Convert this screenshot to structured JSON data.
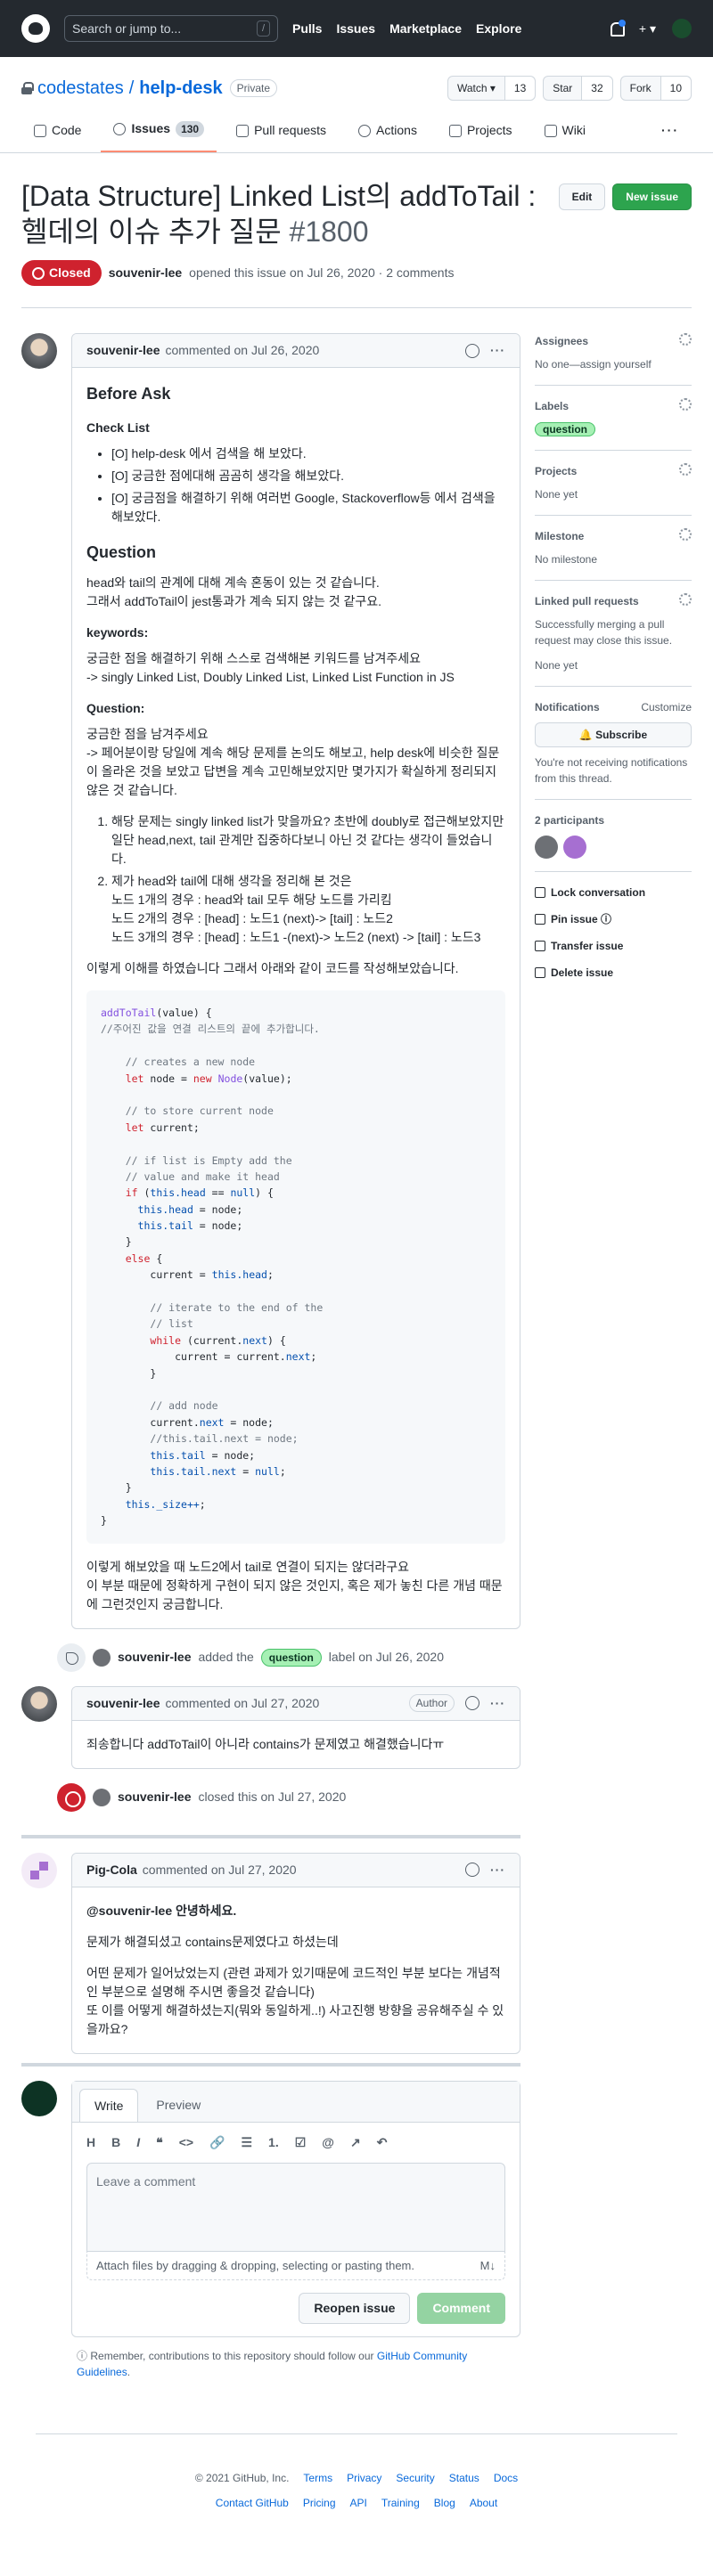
{
  "header": {
    "search_placeholder": "Search or jump to...",
    "slash": "/",
    "nav": [
      "Pulls",
      "Issues",
      "Marketplace",
      "Explore"
    ],
    "plus": "+ ▾"
  },
  "repo": {
    "owner": "codestates",
    "sep": "/",
    "name": "help-desk",
    "visibility": "Private",
    "watch": "Watch ▾",
    "watch_count": "13",
    "star": "Star",
    "star_count": "32",
    "fork": "Fork",
    "fork_count": "10"
  },
  "tabs": [
    {
      "label": "Code"
    },
    {
      "label": "Issues",
      "count": "130"
    },
    {
      "label": "Pull requests"
    },
    {
      "label": "Actions"
    },
    {
      "label": "Projects"
    },
    {
      "label": "Wiki"
    }
  ],
  "issue": {
    "title": "[Data Structure] Linked List의 addToTail : 헬데의 이슈 추가 질문",
    "number": "#1800",
    "edit": "Edit",
    "new_issue": "New issue",
    "state": "Closed",
    "author": "souvenir-lee",
    "meta_rest": "opened this issue on Jul 26, 2020 · 2 comments"
  },
  "comment1": {
    "author": "souvenir-lee",
    "meta": "commented on Jul 26, 2020",
    "h_before": "Before Ask",
    "h_check": "Check List",
    "checklist": [
      "[O] help-desk 에서 검색을 해 보았다.",
      "[O] 궁금한 점에대해 곰곰히 생각을 해보았다.",
      "[O] 궁금점을 해결하기 위해 여러번 Google, Stackoverflow등 에서 검색을 해보았다."
    ],
    "h_question": "Question",
    "q1": "head와 tail의 관계에 대해 계속 혼동이 있는 것 같습니다.",
    "q2": "그래서 addToTail이 jest통과가 계속 되지 않는 것 같구요.",
    "h_keywords": "keywords:",
    "kw1": "궁금한 점을 해결하기 위해 스스로 검색해본 키워드를 남겨주세요",
    "kw2": "-> singly Linked List, Doubly Linked List, Linked List Function in JS",
    "h_question2": "Question:",
    "qq1": "궁금한 점을 남겨주세요",
    "qq2": "-> 페어분이랑 당일에 계속 해당 문제를 논의도 해보고, help desk에 비슷한 질문이 올라온 것을 보았고 답변을 계속 고민해보았지만 몇가지가 확실하게 정리되지 않은 것 같습니다.",
    "ol1": "해당 문제는 singly linked list가 맞을까요? 초반에 doubly로 접근해보았지만 일단 head,next, tail 관계만 집중하다보니 아닌 것 같다는 생각이 들었습니다.",
    "ol2": "제가 head와 tail에 대해 생각을 정리해 본 것은",
    "ol2a": "노드 1개의 경우 : head와 tail 모두 해당 노드를 가리킴",
    "ol2b": "노드 2개의 경우 : [head] : 노드1 (next)-> [tail] : 노드2",
    "ol2c": "노드 3개의 경우 : [head] : 노드1 -(next)-> 노드2 (next) -> [tail] : 노드3",
    "pcode": "이렇게 이해를 하였습니다 그래서 아래와 같이 코드를 작성해보았습니다.",
    "after1": "이렇게 해보았을 때 노드2에서 tail로 연결이 되지는 않더라구요",
    "after2": "이 부분 때문에 정확하게 구현이 되지 않은 것인지, 혹은 제가 놓친 다른 개념 때문에 그런것인지 궁금합니다."
  },
  "code": {
    "fn": "addToTail",
    "args": "(value) {",
    "c0": "//주어진 값을 연결 리스트의 끝에 추가합니다.",
    "c1": "// creates a new node",
    "l1k": "let",
    "l1": " node = ",
    "l1n": "new",
    "l1c": "Node",
    "l1e": "(value);",
    "c2": "// to store current node",
    "l2k": "let",
    "l2": " current;",
    "c3": "// if list is Empty add the",
    "c4": "// value and make it head",
    "l3k": "if",
    "l3": " (",
    "l3t": "this",
    "l3h": ".head",
    "l3e": " == ",
    "l3nl": "null",
    "l3z": ") {",
    "l4t": "this",
    "l4h": ".head",
    "l4": " = node;",
    "l5t": "this",
    "l5h": ".tail",
    "l5": " = node;",
    "l6": "}",
    "l7k": "else",
    "l7": " {",
    "l8": "current = ",
    "l8t": "this",
    "l8h": ".head",
    "l8e": ";",
    "c5": "// iterate to the end of the",
    "c6": "// list",
    "l9k": "while",
    "l9": " (current.",
    "l9n": "next",
    "l9e": ") {",
    "l10": "current = current.",
    "l10n": "next",
    "l10e": ";",
    "l11": "}",
    "c7": "// add node",
    "l12": "current.",
    "l12n": "next",
    "l12e": " = node;",
    "c8": "//this.tail.next = node;",
    "l13t": "this",
    "l13h": ".tail",
    "l13": " = node;",
    "l14t": "this",
    "l14h": ".tail.next",
    "l14e": " = ",
    "l14nl": "null",
    "l14z": ";",
    "l15": "}",
    "l16t": "this",
    "l16h": "._size++",
    "l16e": ";",
    "l17": "}"
  },
  "event1": {
    "actor": "souvenir-lee",
    "pre": "added the",
    "label": "question",
    "post": "label on Jul 26, 2020"
  },
  "comment2": {
    "author": "souvenir-lee",
    "meta": "commented on Jul 27, 2020",
    "badge": "Author",
    "body": "죄송합니다 addToTail이 아니라 contains가 문제였고 해결했습니다ㅠ"
  },
  "event2": {
    "actor": "souvenir-lee",
    "post": "closed this on Jul 27, 2020"
  },
  "comment3": {
    "author": "Pig-Cola",
    "meta": "commented on Jul 27, 2020",
    "b1": "@souvenir-lee 안녕하세요.",
    "b2": "문제가 해결되셨고 contains문제였다고 하셨는데",
    "b3": "어떤 문제가 일어났었는지 (관련 과제가 있기때문에 코드적인 부분 보다는 개념적인 부분으로 설명해 주시면 좋을것 같습니다)",
    "b4": "또 이를 어떻게 해결하셨는지(뭐와 동일하게..!) 사고진행 방향을 공유해주실 수 있을까요?"
  },
  "composer": {
    "write": "Write",
    "preview": "Preview",
    "tools": [
      "H",
      "B",
      "I",
      "❝",
      "<>",
      "🔗",
      "☰",
      "1.",
      "☑",
      "@",
      "↗",
      "↶"
    ],
    "placeholder": "Leave a comment",
    "attach": "Attach files by dragging & dropping, selecting or pasting them.",
    "md": "M↓",
    "reopen": "Reopen issue",
    "comment": "Comment",
    "note_pre": "Remember, contributions to this repository should follow our",
    "note_link": "GitHub Community Guidelines",
    "note_post": "."
  },
  "sidebar": {
    "assignees": "Assignees",
    "assignees_val": "No one—assign yourself",
    "labels": "Labels",
    "labels_val": "question",
    "projects": "Projects",
    "projects_val": "None yet",
    "milestone": "Milestone",
    "milestone_val": "No milestone",
    "linked": "Linked pull requests",
    "linked_desc": "Successfully merging a pull request may close this issue.",
    "linked_val": "None yet",
    "notifications": "Notifications",
    "customize": "Customize",
    "subscribe": "🔔 Subscribe",
    "notif_desc": "You're not receiving notifications from this thread.",
    "participants": "2 participants",
    "actions": [
      "Lock conversation",
      "Pin issue ⓘ",
      "Transfer issue",
      "Delete issue"
    ]
  },
  "footer": {
    "copy": "© 2021 GitHub, Inc.",
    "row1": [
      "Terms",
      "Privacy",
      "Security",
      "Status",
      "Docs"
    ],
    "row2": [
      "Contact GitHub",
      "Pricing",
      "API",
      "Training",
      "Blog",
      "About"
    ]
  }
}
